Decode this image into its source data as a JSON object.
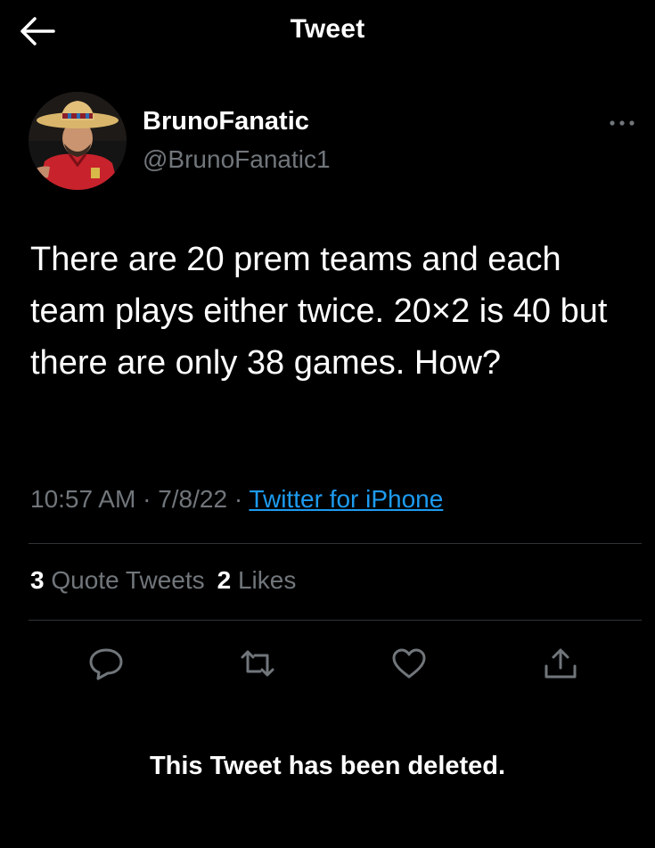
{
  "header": {
    "title": "Tweet",
    "back_icon": "arrow-left-icon"
  },
  "author": {
    "display_name": "BrunoFanatic",
    "handle": "@BrunoFanatic1",
    "avatar_desc": "avatar-photo"
  },
  "tweet": {
    "text": "There are 20 prem teams and each team plays either twice. 20×2 is 40 but there are only 38 games. How?",
    "time": "10:57 AM",
    "separator": "·",
    "date": "7/8/22",
    "source": "Twitter for iPhone"
  },
  "stats": {
    "quote_count": "3",
    "quote_label": "Quote Tweets",
    "like_count": "2",
    "like_label": "Likes"
  },
  "actions": {
    "reply_icon": "reply-icon",
    "retweet_icon": "retweet-icon",
    "like_icon": "heart-icon",
    "share_icon": "share-icon",
    "more_icon": "more-dots-icon"
  },
  "notice": {
    "deleted": "This Tweet has been deleted."
  },
  "colors": {
    "background": "#000000",
    "text_primary": "#ffffff",
    "text_secondary": "#71767b",
    "link": "#1d9bf0",
    "divider": "#2f3336"
  }
}
